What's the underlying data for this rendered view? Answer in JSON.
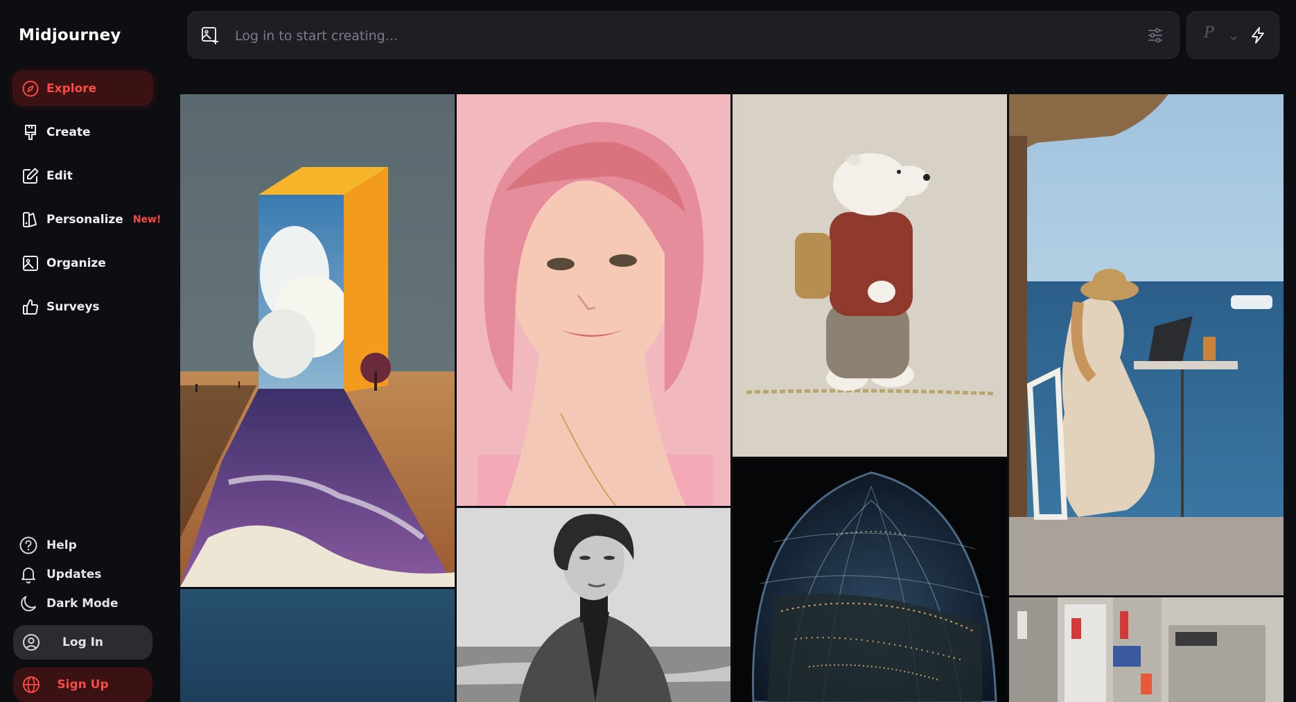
{
  "brand": "Midjourney",
  "nav": [
    {
      "label": "Explore",
      "icon": "compass-icon",
      "active": true
    },
    {
      "label": "Create",
      "icon": "paintbrush-icon"
    },
    {
      "label": "Edit",
      "icon": "edit-icon"
    },
    {
      "label": "Personalize",
      "icon": "personalize-icon",
      "badge": "New!"
    },
    {
      "label": "Organize",
      "icon": "image-icon"
    },
    {
      "label": "Surveys",
      "icon": "thumbs-up-icon"
    }
  ],
  "bottom_links": [
    {
      "label": "Help",
      "icon": "help-icon"
    },
    {
      "label": "Updates",
      "icon": "bell-icon"
    },
    {
      "label": "Dark Mode",
      "icon": "moon-icon"
    }
  ],
  "buttons": {
    "login": "Log In",
    "signup": "Sign Up"
  },
  "prompt": {
    "placeholder": "Log in to start creating..."
  },
  "mode": {
    "label": "P"
  },
  "gallery": {
    "tiles": [
      {
        "subject": "Surreal desert doorway with clouds and sea"
      },
      {
        "subject": "Portrait of woman with pink bob haircut"
      },
      {
        "subject": "Embroidered polar bear with backpack"
      },
      {
        "subject": "Woman working on laptop by the sea"
      },
      {
        "subject": "Deep blue texture"
      },
      {
        "subject": "Black and white portrait of woman in coat"
      },
      {
        "subject": "Glowing city lights inside glass dome"
      },
      {
        "subject": "Aerial view of city buildings"
      }
    ]
  },
  "colors": {
    "accent": "#ff4b42",
    "background": "#0d0e12",
    "panel": "#1e1f24"
  }
}
